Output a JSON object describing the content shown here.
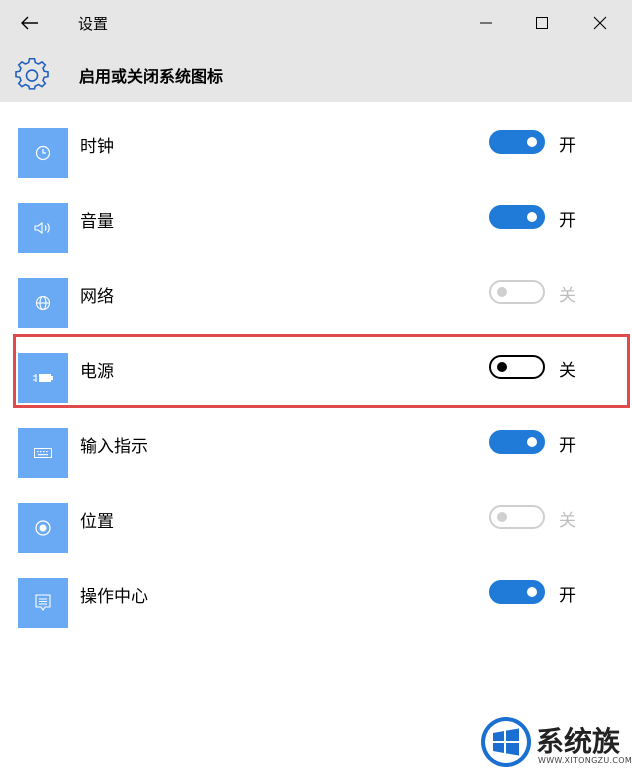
{
  "window": {
    "title": "设置",
    "back_icon": "back-arrow-icon",
    "minimize_icon": "minimize-icon",
    "maximize_icon": "maximize-icon",
    "close_icon": "close-icon"
  },
  "header": {
    "icon": "gear-icon",
    "title": "启用或关闭系统图标"
  },
  "colors": {
    "tile": "#6aaaf5",
    "toggle_on": "#1f7ad8",
    "highlight": "#e04a4a",
    "titlebar": "#e6e6e6"
  },
  "items": [
    {
      "label": "时钟",
      "state": "开",
      "on": true,
      "enabled": true,
      "icon": "clock-icon"
    },
    {
      "label": "音量",
      "state": "开",
      "on": true,
      "enabled": true,
      "icon": "speaker-icon"
    },
    {
      "label": "网络",
      "state": "关",
      "on": false,
      "enabled": false,
      "icon": "globe-icon"
    },
    {
      "label": "电源",
      "state": "关",
      "on": false,
      "enabled": true,
      "icon": "battery-plug-icon"
    },
    {
      "label": "输入指示",
      "state": "开",
      "on": true,
      "enabled": true,
      "icon": "keyboard-icon"
    },
    {
      "label": "位置",
      "state": "关",
      "on": false,
      "enabled": false,
      "icon": "location-icon"
    },
    {
      "label": "操作中心",
      "state": "开",
      "on": true,
      "enabled": true,
      "icon": "action-center-icon"
    }
  ],
  "watermark": {
    "text": "系统族",
    "subtext": "WWW.XITONGZU.COM"
  }
}
